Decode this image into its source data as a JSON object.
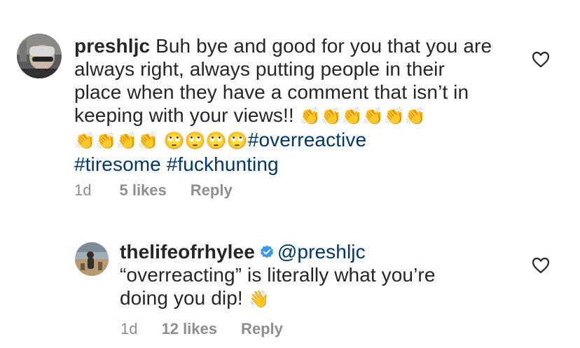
{
  "comments": [
    {
      "username": "preshljc",
      "text_1": "Buh bye and good for you that you are",
      "text_2": "always right, always putting people in their",
      "text_3": "place when they have a comment that isn’t in",
      "text_4": "keeping with your views!!",
      "emoji_clap": "👏",
      "emoji_eyeroll": "🙄",
      "hashtag_1": "#overreactive",
      "hashtag_2": "#tiresome",
      "hashtag_3": "#fuckhunting",
      "time": "1d",
      "likes": "5 likes",
      "reply": "Reply",
      "like_icon": "heart-outline-icon"
    },
    {
      "username": "thelifeofrhylee",
      "verified_icon": "verified-badge-icon",
      "mention": "@preshljc",
      "text_1": "“overreacting” is literally what you’re",
      "text_2": "doing you dip!",
      "emoji_wave": "👋",
      "time": "1d",
      "likes": "12 likes",
      "reply": "Reply",
      "like_icon": "heart-outline-icon"
    }
  ],
  "colors": {
    "text": "#262626",
    "secondary": "#8e8e8e",
    "link": "#00376b",
    "verified": "#3897f0"
  }
}
